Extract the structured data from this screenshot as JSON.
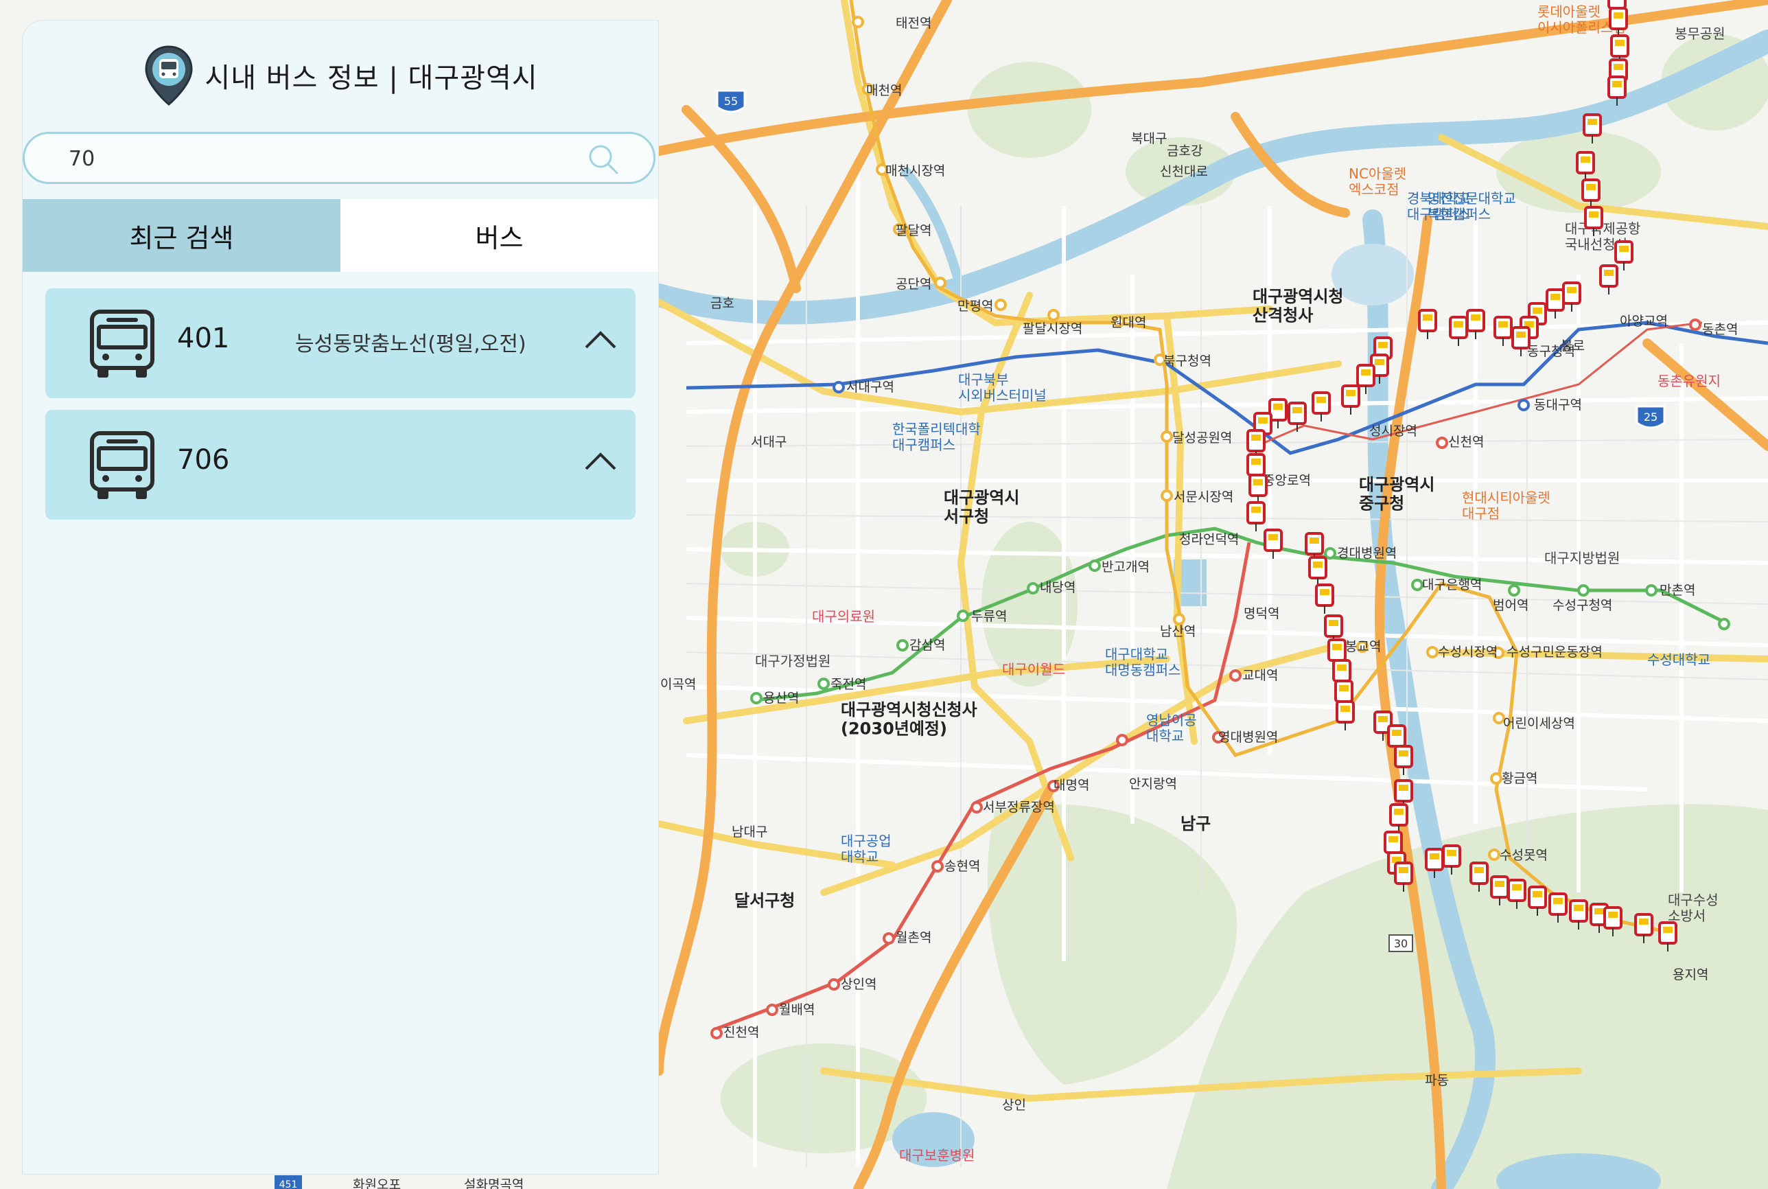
{
  "app": {
    "title": "시내 버스 정보 | 대구광역시"
  },
  "search": {
    "value": "70",
    "placeholder": ""
  },
  "tabs": [
    {
      "label": "최근 검색",
      "active": true
    },
    {
      "label": "버스",
      "active": false
    }
  ],
  "results": [
    {
      "number": "401",
      "description": "능성동맞춤노선(평일,오전)"
    },
    {
      "number": "706",
      "description": ""
    }
  ],
  "map": {
    "labels": {
      "taejeon": "태전역",
      "maecheon": "매천역",
      "maecheon_market": "매천시장역",
      "palgak": "팔달역",
      "gongdan": "공단역",
      "mangwon": "만평역",
      "palgak_market": "팔달시장역",
      "wondae": "원대역",
      "bukgu_office": "북구청역",
      "seodaegu": "서대구역",
      "dalseong_park": "달성공원역",
      "seomun_market": "서문시장역",
      "cheongna": "청라언덕역",
      "bangogae": "반고개역",
      "naedang": "내당역",
      "duryu": "두류역",
      "gamsam": "감삼역",
      "jukjeon": "죽전역",
      "yongsan": "용산역",
      "igok": "이곡역",
      "myeongdeok": "명덕역",
      "kyodae": "교대역",
      "yeongdae_hosp": "영대병원역",
      "anjirang": "안지랑역",
      "daemyeong": "대명역",
      "seobu_terminal": "서부정류장역",
      "songhyeon": "송현역",
      "wolchon": "월촌역",
      "sangin": "상인역",
      "wolbae": "월배역",
      "jincheon": "진천역",
      "namsan": "남산역",
      "jungang": "중앙로역",
      "banwoldang": "성시장역",
      "sincheon": "신천역",
      "dongdaegu": "동대구역",
      "dongdaegu_office": "동구청역",
      "ayang": "아양교역",
      "dongchon": "동촌역",
      "kyungpook_hosp": "경대병원역",
      "daegu_bank": "대구은행역",
      "beomeo": "범어역",
      "suseong_office": "수성구청역",
      "mancheon": "만촌역",
      "bongdeok": "봉교역",
      "suseong_market": "수성시장역",
      "suseong_citizen": "수성구민운동장역",
      "children": "어린이세상역",
      "hwanggeum": "황금역",
      "suseong_lake": "수성못역",
      "yongji": "용지역",
      "north_daegu_ic": "북대구",
      "geumho_river": "금호강",
      "sincheon_road": "신천대로",
      "geumho_ic": "금호",
      "nc_outlet": "NC아울렛\n엑스코점",
      "yeongjin": "영진전문대학교\n복현캠퍼스",
      "knu": "경북대학교\n대구캠퍼스",
      "city_hall_sangyeok": "대구광역시청\n산격청사",
      "daebuk_terminal": "대구북부\n시외버스터미널",
      "polytech": "한국폴리텍대학\n대구캠퍼스",
      "seogu_office": "대구광역시\n서구청",
      "junggu_office": "대구광역시\n중구청",
      "hyundai_outlet": "현대시티아울렛\n대구점",
      "daegu_court": "대구지방법원",
      "suseong_univ": "수성대학교",
      "daegu_medical": "대구의료원",
      "family_court": "대구가정법원",
      "new_city_hall": "대구광역시청신청사\n(2030년예정)",
      "eworld": "대구이월드",
      "daegu_univ": "대구대학교\n대명동캠퍼스",
      "yeungnam_tech": "영남이공\n대학교",
      "namgu": "남구",
      "daegu_tech": "대구공업\n대학교",
      "dalseo_office": "달서구청",
      "namdaegu": "남대구",
      "seodaegu_ic": "서대구",
      "sangin_ic": "상인",
      "pado": "파동",
      "bohun_hosp": "대구보훈병원",
      "suseong_fire": "대구수성\n소방서",
      "lotte_outlet": "롯데아울렛\n이시아폴리스점",
      "bongmu_park": "봉무공원",
      "dongchon_resort": "동촌유원지",
      "bulro": "불로",
      "airport": "대구국제공항\n국내선청사",
      "hwawon": "화원오포",
      "seolhwa": "설화명곡역",
      "sincheon_daero_v": "신천대로",
      "geumho_river2": "금호강",
      "shield55": "55",
      "shield25": "25",
      "shield30": "30",
      "shield451": "451"
    }
  },
  "colors": {
    "panel_bg": "#eef8fa",
    "tab_active": "#a9d3df",
    "item_bg": "#bde7ee",
    "search_border": "#9fd3df",
    "bus_marker_red": "#c8202a",
    "bus_marker_yellow": "#f4c20d"
  },
  "icons": {
    "header": "bus-location-pin-icon",
    "search": "search-icon",
    "result": "bus-icon",
    "expand": "chevron-up-icon"
  }
}
